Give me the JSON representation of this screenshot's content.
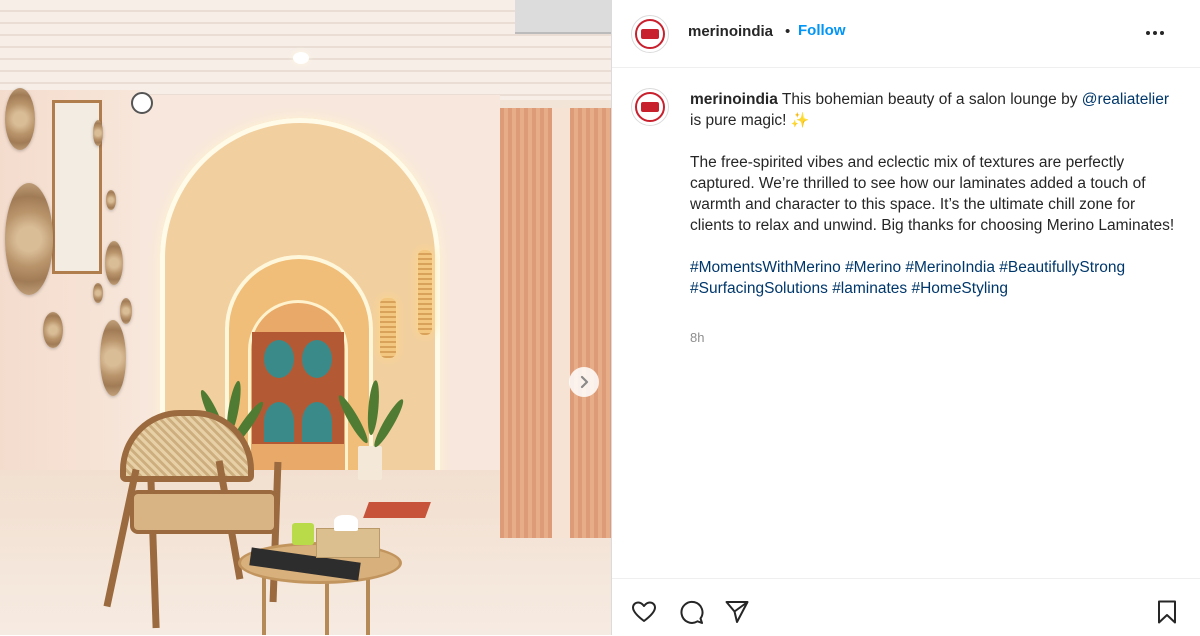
{
  "post": {
    "username": "merinoindia",
    "separator": "•",
    "follow_label": "Follow",
    "caption": {
      "username": "merinoindia",
      "text_1": " This bohemian beauty of a salon lounge by ",
      "mention": "@realiatelier",
      "text_2": " is pure magic! ",
      "sparkle": "✨",
      "paragraph_2": "The free-spirited vibes and eclectic mix of textures are perfectly captured. We’re thrilled to see how our laminates added a touch of warmth and character to this space. It’s the ultimate chill zone for clients to relax and unwind. Big thanks for choosing Merino Laminates!",
      "hashtags": [
        "#MomentsWithMerino",
        "#Merino",
        "#MerinoIndia",
        "#BeautifullyStrong",
        "#SurfacingSolutions",
        "#laminates",
        "#HomeStyling"
      ]
    },
    "time": "8h"
  },
  "icons": {
    "like": "heart-icon",
    "comment": "comment-icon",
    "share": "paper-plane-icon",
    "save": "bookmark-icon",
    "more": "more-options-icon",
    "next": "chevron-right-icon"
  },
  "colors": {
    "accent": "#0095f6",
    "link": "#00376b",
    "brand": "#c8202d",
    "muted": "#8e8e8e"
  }
}
